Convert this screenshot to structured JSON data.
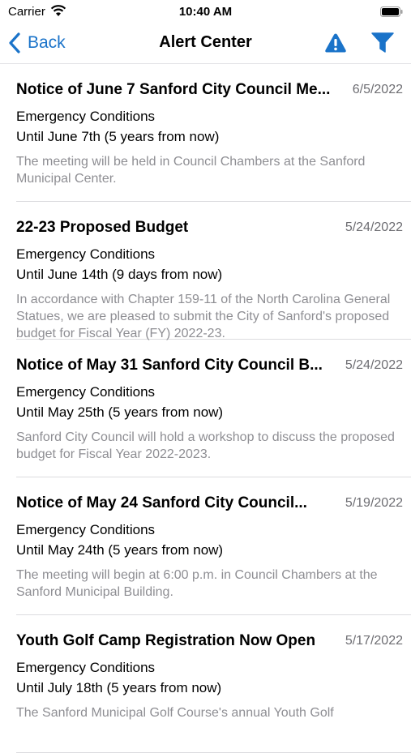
{
  "status_bar": {
    "carrier": "Carrier",
    "time": "10:40 AM"
  },
  "nav": {
    "back_label": "Back",
    "title": "Alert Center",
    "accent_color": "#1a73c9"
  },
  "alerts": [
    {
      "title": "Notice of June 7 Sanford City Council Me...",
      "date": "6/5/2022",
      "category": "Emergency Conditions",
      "expiry": "Until June 7th (5 years from now)",
      "description": "The meeting will be held in Council Chambers at the Sanford Municipal Center."
    },
    {
      "title": "22-23 Proposed Budget",
      "date": "5/24/2022",
      "category": "Emergency Conditions",
      "expiry": "Until June 14th (9 days from now)",
      "description": "In accordance with Chapter 159-11 of the North Carolina General Statues, we are pleased to submit the City of Sanford's proposed budget for Fiscal Year (FY) 2022-23."
    },
    {
      "title": "Notice of May 31 Sanford City Council B...",
      "date": "5/24/2022",
      "category": "Emergency Conditions",
      "expiry": "Until May 25th (5 years from now)",
      "description": "Sanford City Council will hold a workshop to discuss the proposed budget for Fiscal Year 2022-2023."
    },
    {
      "title": "Notice of May 24 Sanford City Council...",
      "date": "5/19/2022",
      "category": "Emergency Conditions",
      "expiry": "Until May 24th (5 years from now)",
      "description": "The meeting will begin at 6:00 p.m. in Council Chambers at the Sanford Municipal Building."
    },
    {
      "title": "Youth Golf Camp Registration Now Open",
      "date": "5/17/2022",
      "category": "Emergency Conditions",
      "expiry": "Until July 18th (5 years from now)",
      "description": "The Sanford Municipal Golf Course's annual Youth Golf"
    }
  ]
}
